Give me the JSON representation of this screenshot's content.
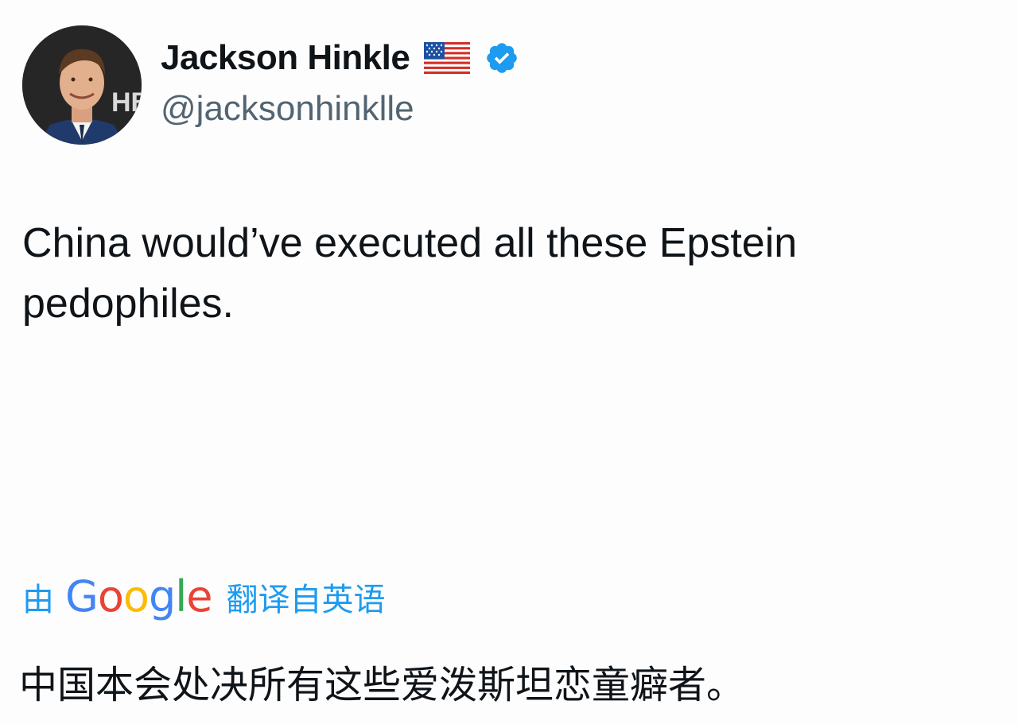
{
  "author": {
    "display_name": "Jackson Hinkle",
    "handle": "@jacksonhinklle",
    "flag_icon": "us-flag-icon",
    "verified_icon": "verified-badge-icon",
    "avatar_backdrop_text": "HB"
  },
  "tweet": {
    "text": "China would’ve executed all these Epstein pedophiles."
  },
  "translation": {
    "prefix": "由",
    "google": {
      "letters": [
        "G",
        "o",
        "o",
        "g",
        "l",
        "e"
      ],
      "colors": [
        "#4285f4",
        "#ea4335",
        "#fbbc05",
        "#4285f4",
        "#34a853",
        "#ea4335"
      ]
    },
    "suffix": "翻译自英语",
    "translated_text": "中国本会处决所有这些爱泼斯坦恋童癖者。"
  },
  "colors": {
    "accent": "#1d9bf0",
    "verified": "#1d9bf0",
    "handle_gray": "#536471",
    "text": "#0f1419"
  }
}
